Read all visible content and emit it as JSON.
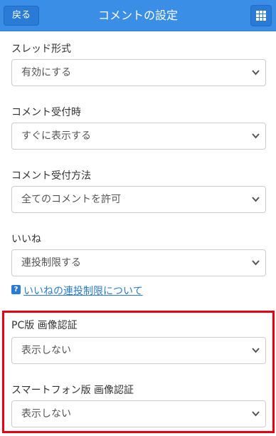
{
  "header": {
    "back_label": "戻る",
    "title": "コメントの設定",
    "menu_icon": "grid-icon",
    "background_color": "#3a8ee6"
  },
  "settings": [
    {
      "label": "スレッド形式",
      "value": "有効にする"
    },
    {
      "label": "コメント受付時",
      "value": "すぐに表示する"
    },
    {
      "label": "コメント受付方法",
      "value": "全てのコメントを許可"
    },
    {
      "label": "いいね",
      "value": "連投制限する"
    },
    {
      "label": "PC版 画像認証",
      "value": "表示しない"
    },
    {
      "label": "スマートフォン版 画像認証",
      "value": "表示しない"
    }
  ],
  "help": {
    "icon_text": "?",
    "link_text": "いいねの連投制限について",
    "link_color": "#2a7bd6"
  },
  "highlight": {
    "color": "#e60012"
  }
}
